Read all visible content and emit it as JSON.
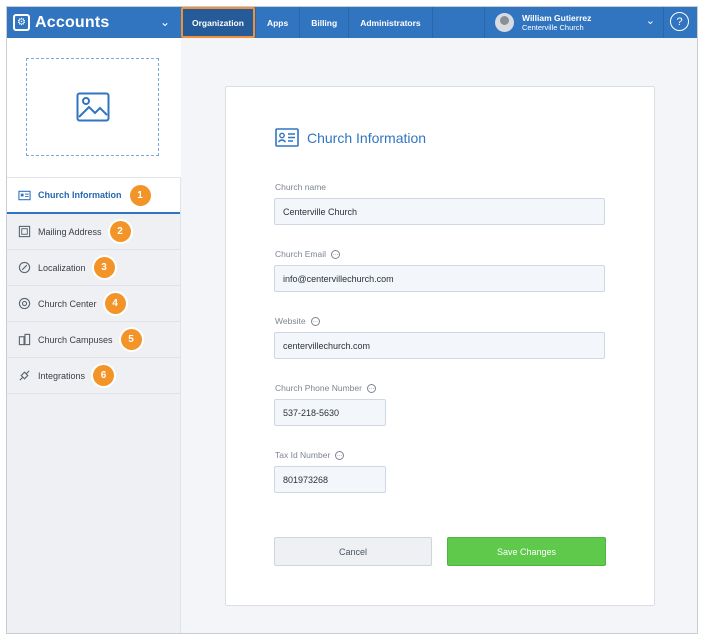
{
  "app": {
    "title": "Accounts",
    "icon": "gear-box-icon"
  },
  "topnav": {
    "items": [
      {
        "label": "Organization",
        "active": true
      },
      {
        "label": "Apps"
      },
      {
        "label": "Billing"
      },
      {
        "label": "Administrators"
      }
    ]
  },
  "user": {
    "name": "William Gutierrez",
    "org": "Centerville Church"
  },
  "help": {
    "symbol": "?"
  },
  "sidebar": {
    "items": [
      {
        "label": "Church Information",
        "badge": "1",
        "icon": "id-card-icon",
        "active": true
      },
      {
        "label": "Mailing Address",
        "badge": "2",
        "icon": "map-icon"
      },
      {
        "label": "Localization",
        "badge": "3",
        "icon": "compass-icon"
      },
      {
        "label": "Church Center",
        "badge": "4",
        "icon": "church-center-icon"
      },
      {
        "label": "Church Campuses",
        "badge": "5",
        "icon": "buildings-icon"
      },
      {
        "label": "Integrations",
        "badge": "6",
        "icon": "plug-icon"
      }
    ]
  },
  "form": {
    "title": "Church Information",
    "fields": [
      {
        "label": "Church name",
        "value": "Centerville Church"
      },
      {
        "label": "Church Email",
        "value": "info@centervillechurch.com"
      },
      {
        "label": "Website",
        "value": "centervillechurch.com"
      },
      {
        "label": "Church Phone Number",
        "value": "537-218-5630"
      },
      {
        "label": "Tax Id Number",
        "value": "801973268"
      }
    ],
    "cancel_label": "Cancel",
    "save_label": "Save Changes"
  },
  "colors": {
    "brand": "#3175c1",
    "badge": "#f29427",
    "save": "#5ec94a",
    "highlight": "#f0903a"
  }
}
